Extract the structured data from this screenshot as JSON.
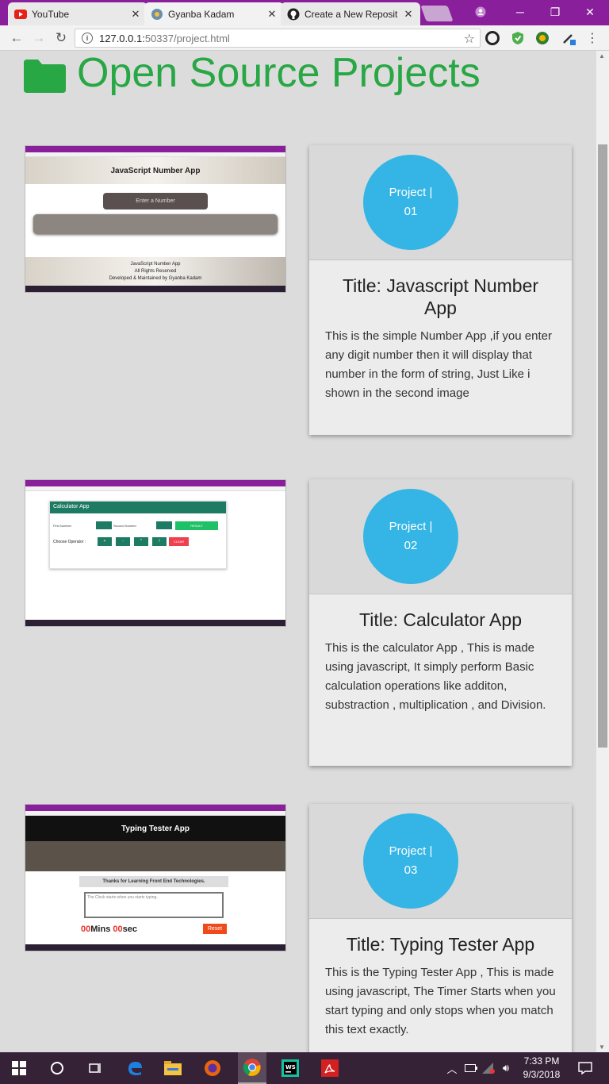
{
  "browser": {
    "tabs": [
      {
        "label": "YouTube",
        "icon": "youtube-icon"
      },
      {
        "label": "Gyanba Kadam",
        "icon": "site-icon"
      },
      {
        "label": "Create a New Reposit",
        "icon": "github-icon"
      }
    ],
    "url_host": "127.0.0.1:",
    "url_path": "50337/project.html"
  },
  "page": {
    "title": "Open Source Projects",
    "projects": [
      {
        "badge_line1": "Project |",
        "badge_line2": "01",
        "title": "Title: Javascript Number App",
        "description": "This is the simple Number App ,if you enter any digit number then it will display that number in the form of string, Just Like i shown in the second image",
        "screenshot": {
          "header": "JavaScript Number App",
          "input_placeholder": "Enter a Number",
          "footer_line1": "JavaScript Number App",
          "footer_line2": "All Rights Reserved",
          "footer_line3": "Developed & Maintained by Gyanba Kadam"
        }
      },
      {
        "badge_line1": "Project |",
        "badge_line2": "02",
        "title": "Title: Calculator App",
        "description": "This is the calculator App , This is made using javascript, It simply perform Basic calculation operations like additon, substraction , multiplication , and Division.",
        "screenshot": {
          "header": "Calculator App",
          "first_number": "First Number",
          "second_number": "Second Number",
          "result": "RESULT",
          "operator_label": "Choose Operator :",
          "ops": [
            "+",
            "-",
            "*",
            "/"
          ],
          "clear": "CLEAR"
        }
      },
      {
        "badge_line1": "Project |",
        "badge_line2": "03",
        "title": "Title: Typing Tester App",
        "description": "This is the Typing Tester App , This is made using javascript, The Timer Starts when you start typing and only stops when you match this text exactly.",
        "screenshot": {
          "header": "Typing Tester App",
          "banner": "Thanks for Learning Front End Technologies.",
          "textarea_placeholder": "The Clock starts when you starts typing..",
          "mins_value": "00",
          "mins_label": "Mins",
          "secs_value": "00",
          "secs_label": "sec",
          "reset": "Reset"
        }
      }
    ]
  },
  "taskbar": {
    "time": "7:33 PM",
    "date": "9/3/2018"
  },
  "colors": {
    "heading_green": "#28a745",
    "badge_blue": "#34b5e5",
    "chrome_purple": "#8a1f9c",
    "taskbar": "#352236"
  }
}
